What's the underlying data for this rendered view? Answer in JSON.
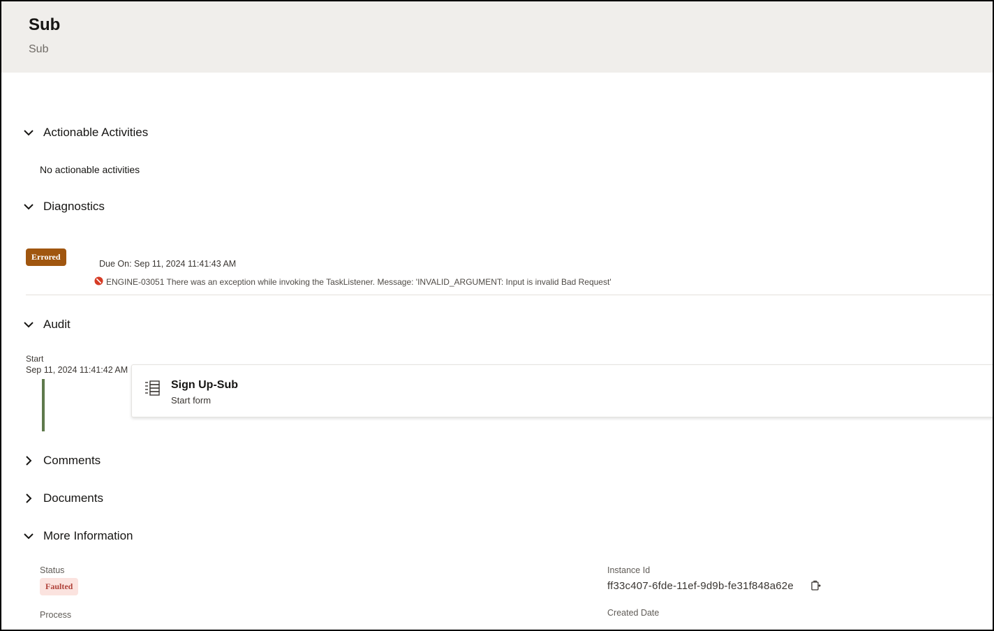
{
  "header": {
    "title": "Sub",
    "subtitle": "Sub"
  },
  "sections": {
    "actionable": {
      "label": "Actionable Activities",
      "empty_text": "No actionable activities",
      "expanded": true
    },
    "diagnostics": {
      "label": "Diagnostics",
      "expanded": true,
      "badge": "Errored",
      "due_on": "Due On: Sep 11, 2024 11:41:43 AM",
      "error_message": "ENGINE-03051 There was an exception while invoking the TaskListener. Message: 'INVALID_ARGUMENT: Input is invalid Bad Request'"
    },
    "audit": {
      "label": "Audit",
      "expanded": true,
      "start_label": "Start",
      "start_time": "Sep 11, 2024 11:41:42 AM",
      "item": {
        "title": "Sign Up-Sub",
        "subtitle": "Start form",
        "icon": "list-form-icon"
      }
    },
    "comments": {
      "label": "Comments",
      "expanded": false
    },
    "documents": {
      "label": "Documents",
      "expanded": false
    },
    "more_info": {
      "label": "More Information",
      "expanded": true,
      "status_label": "Status",
      "status_value": "Faulted",
      "process_label": "Process",
      "instance_label": "Instance Id",
      "instance_value": "ff33c407-6fde-11ef-9d9b-fe31f848a62e",
      "created_label": "Created Date"
    }
  },
  "colors": {
    "header_bg": "#f0eeeb",
    "errored_badge": "#a0560f",
    "faulted_badge_bg": "#fbe3df",
    "faulted_badge_text": "#b0423a",
    "timeline": "#5f7a4c",
    "error_icon": "#d63b25"
  }
}
